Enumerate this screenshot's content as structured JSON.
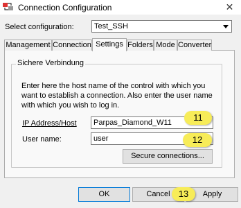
{
  "window": {
    "title": "Connection Configuration",
    "close_glyph": "✕",
    "app_icon": "connection-app-icon"
  },
  "config": {
    "label": "Select configuration:",
    "value": "Test_SSH"
  },
  "tabs": [
    {
      "label": "Management"
    },
    {
      "label": "Connection"
    },
    {
      "label": "Settings",
      "active": true
    },
    {
      "label": "Folders"
    },
    {
      "label": "Mode"
    },
    {
      "label": "Converter"
    }
  ],
  "group": {
    "title": "Sichere Verbindung",
    "description": "Enter here the host name of the control with which you want to establish a connection. Also enter the user name with which you wish to log in."
  },
  "fields": {
    "ip_label": "IP Address/Host",
    "ip_value": "Parpas_Diamond_W11",
    "user_label": "User name:",
    "user_value": "user"
  },
  "buttons": {
    "secure": "Secure connections...",
    "ok": "OK",
    "cancel": "Cancel",
    "apply": "Apply"
  },
  "callouts": {
    "c11": "11",
    "c12": "12",
    "c13": "13",
    "color": "#f7ec58"
  }
}
